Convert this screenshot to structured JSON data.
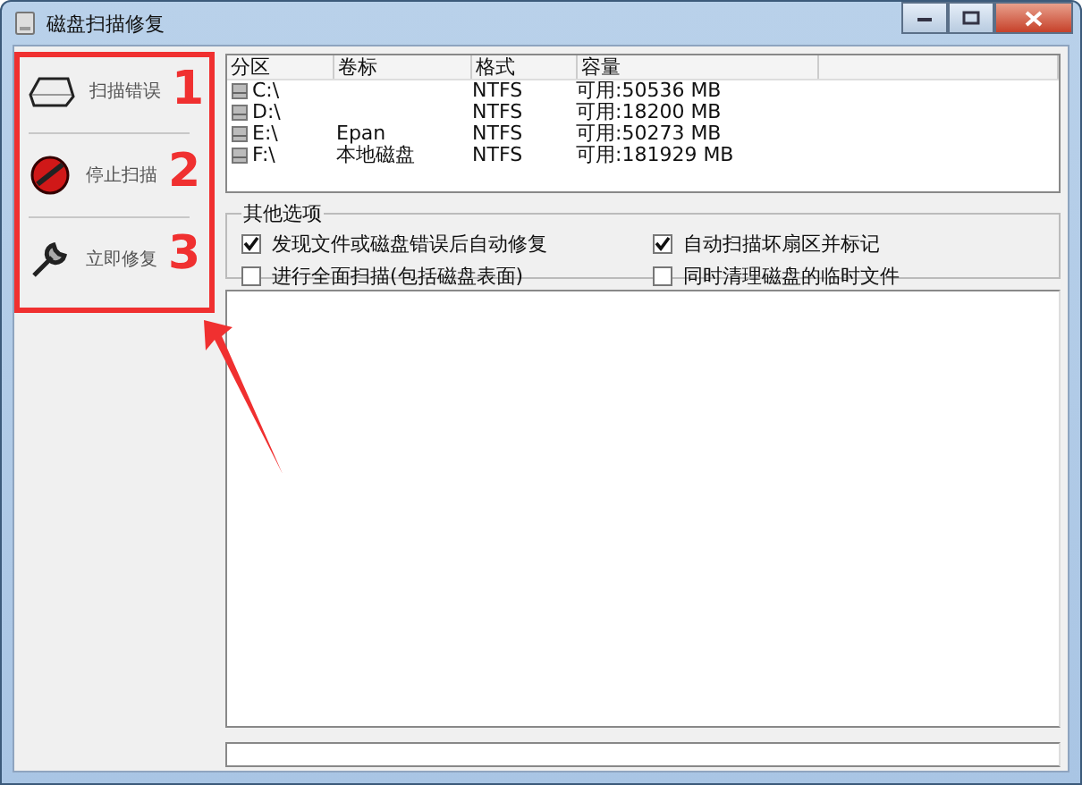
{
  "window": {
    "title": "磁盘扫描修复"
  },
  "sidebar": {
    "items": [
      {
        "label": "扫描错误",
        "kind": "disk"
      },
      {
        "label": "停止扫描",
        "kind": "stop"
      },
      {
        "label": "立即修复",
        "kind": "wrench"
      }
    ]
  },
  "table": {
    "columns": [
      "分区",
      "卷标",
      "格式",
      "容量"
    ],
    "rows": [
      [
        "C:\\",
        "",
        "NTFS",
        "可用:50536 MB"
      ],
      [
        "D:\\",
        "",
        "NTFS",
        "可用:18200 MB"
      ],
      [
        "E:\\",
        "Epan",
        "NTFS",
        "可用:50273 MB"
      ],
      [
        "F:\\",
        "本地磁盘",
        "NTFS",
        "可用:181929 MB"
      ]
    ]
  },
  "options": {
    "title": "其他选项",
    "items": [
      {
        "label": "发现文件或磁盘错误后自动修复",
        "checked": true
      },
      {
        "label": "自动扫描坏扇区并标记",
        "checked": true
      },
      {
        "label": "进行全面扫描(包括磁盘表面)",
        "checked": false
      },
      {
        "label": "同时清理磁盘的临时文件",
        "checked": false
      }
    ]
  },
  "annotations": [
    "1",
    "2",
    "3"
  ]
}
